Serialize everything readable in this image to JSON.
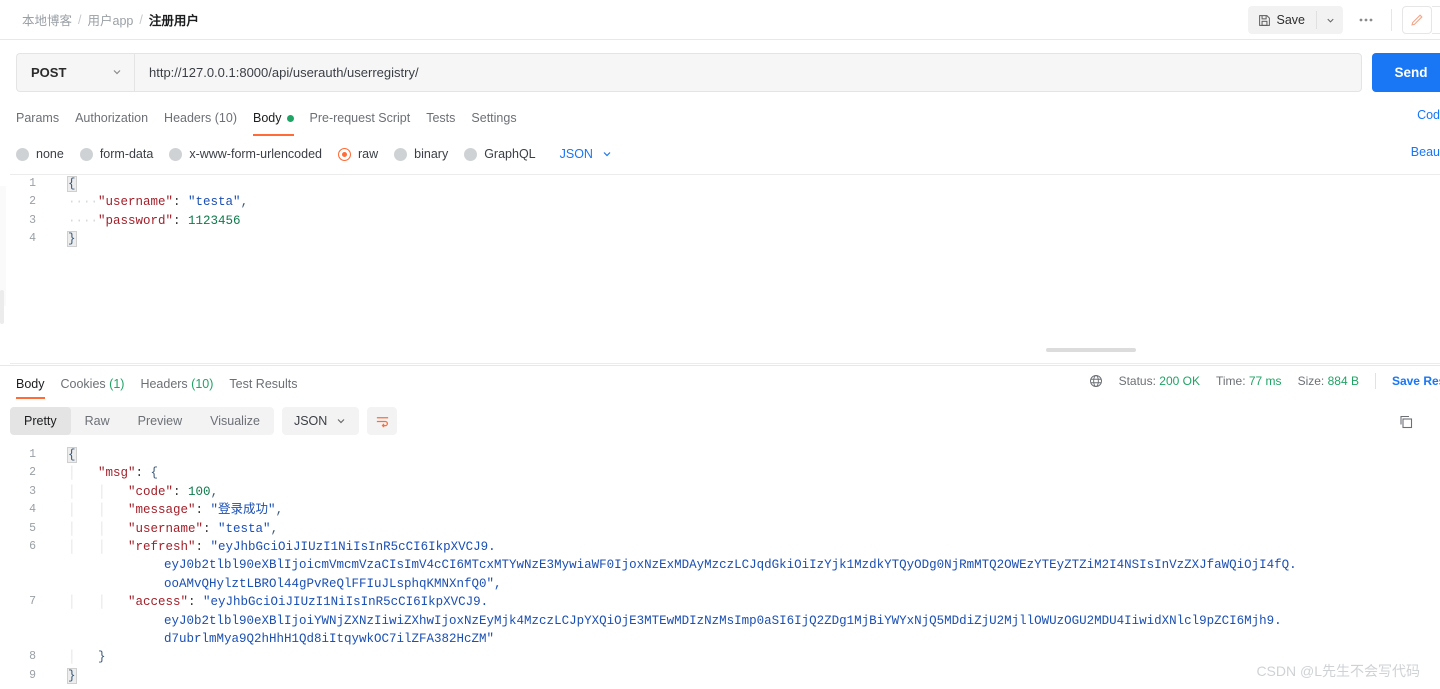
{
  "breadcrumb": {
    "items": [
      {
        "label": "本地博客",
        "current": false
      },
      {
        "label": "用户app",
        "current": false
      },
      {
        "label": "注册用户",
        "current": true
      }
    ],
    "separator": "/"
  },
  "toolbar": {
    "save_label": "Save",
    "save_icon": "floppy-disk-icon",
    "caret_icon": "chevron-down-icon",
    "more_icon": "ellipsis-icon",
    "edit_icon": "pencil-icon"
  },
  "request": {
    "method": "POST",
    "method_caret": "chevron-down-icon",
    "url": "http://127.0.0.1:8000/api/userauth/userregistry/",
    "send_label": "Send",
    "code_link": "Cod",
    "beautify_link": "Beau",
    "tabs": [
      {
        "label": "Params",
        "active": false,
        "dot": false
      },
      {
        "label": "Authorization",
        "active": false,
        "dot": false
      },
      {
        "label": "Headers (10)",
        "active": false,
        "dot": false
      },
      {
        "label": "Body",
        "active": true,
        "dot": true
      },
      {
        "label": "Pre-request Script",
        "active": false,
        "dot": false
      },
      {
        "label": "Tests",
        "active": false,
        "dot": false
      },
      {
        "label": "Settings",
        "active": false,
        "dot": false
      }
    ],
    "body_types": [
      {
        "label": "none",
        "selected": false
      },
      {
        "label": "form-data",
        "selected": false
      },
      {
        "label": "x-www-form-urlencoded",
        "selected": false
      },
      {
        "label": "raw",
        "selected": true
      },
      {
        "label": "binary",
        "selected": false
      },
      {
        "label": "GraphQL",
        "selected": false
      }
    ],
    "format": "JSON",
    "format_caret": "chevron-down-icon",
    "body_lines": [
      {
        "n": "1",
        "text": "{"
      },
      {
        "n": "2",
        "text": "    \"username\": \"testa\","
      },
      {
        "n": "3",
        "text": "    \"password\": 1123456"
      },
      {
        "n": "4",
        "text": "}"
      }
    ]
  },
  "response": {
    "tabs": [
      {
        "label": "Body",
        "count": "",
        "active": true
      },
      {
        "label": "Cookies",
        "count": "(1)",
        "active": false
      },
      {
        "label": "Headers",
        "count": "(10)",
        "active": false
      },
      {
        "label": "Test Results",
        "count": "",
        "active": false
      }
    ],
    "globe_icon": "globe-icon",
    "status_label": "Status:",
    "status_value": "200 OK",
    "time_label": "Time:",
    "time_value": "77 ms",
    "size_label": "Size:",
    "size_value": "884 B",
    "save_response": "Save Respons",
    "views": [
      {
        "label": "Pretty",
        "active": true
      },
      {
        "label": "Raw",
        "active": false
      },
      {
        "label": "Preview",
        "active": false
      },
      {
        "label": "Visualize",
        "active": false
      }
    ],
    "format": "JSON",
    "format_caret": "chevron-down-icon",
    "wrap_icon": "wrap-lines-icon",
    "copy_icon": "copy-icon",
    "lines": [
      {
        "n": "1",
        "text": "{"
      },
      {
        "n": "2",
        "text": "    \"msg\": {"
      },
      {
        "n": "3",
        "text": "        \"code\": 100,"
      },
      {
        "n": "4",
        "text": "        \"message\": \"登录成功\","
      },
      {
        "n": "5",
        "text": "        \"username\": \"testa\","
      },
      {
        "n": "6",
        "text": "        \"refresh\": \"eyJhbGciOiJIUzI1NiIsInR5cCI6IkpXVCJ9.eyJ0b2tlbl90eXBlIjoicmVmcmVzaCIsImV4cCI6MTcxMTYwNzE3MywiaWF0IjoxNzExMDAyMzczLCJqdGkiOiIzYjk1MzdkYTQyODg0NjRmMTQ2OWEzYTEyZTZiM2I4NSIsInVzZXJfaWQiOjI4fQ.ooAMvQHylztLBROl44gPvReQlFFIuJLsphqKMNXnfQ0\","
      },
      {
        "n": "7",
        "text": "        \"access\": \"eyJhbGciOiJIUzI1NiIsInR5cCI6IkpXVCJ9.eyJ0b2tlbl90eXBlIjoiYWNjZXNzIiwiZXhwIjoxNzEyMjk4MzczLCJpYXQiOjE3MTEwMDIzNzMsImp0aSI6IjQ2ZDg1MjBiYWYxNjQ5MDdiZjU2MjllOWUzOGU2MDU4IiwidXNlcl9pZCI6Mjh9.d7ubrlmMya9Q2hHhH1Qd8iItqywkOC7ilZFA382HcZM\""
      },
      {
        "n": "8",
        "text": "    }"
      },
      {
        "n": "9",
        "text": "}"
      }
    ],
    "line6_wrap": [
      "\"refresh\": \"eyJhbGciOiJIUzI1NiIsInR5cCI6IkpXVCJ9.",
      "eyJ0b2tlbl90eXBlIjoicmVmcmVzaCIsImV4cCI6MTcxMTYwNzE3MywiaWF0IjoxNzExMDAyMzczLCJqdGkiOiIzYjk1MzdkYTQyODg0NjRmMTQ2OWEzYTEyZTZiM2I4NSIsInVzZXJfaWQiOjI4fQ.",
      "ooAMvQHylztLBROl44gPvReQlFFIuJLsphqKMNXnfQ0\","
    ],
    "line7_wrap": [
      "\"access\": \"eyJhbGciOiJIUzI1NiIsInR5cCI6IkpXVCJ9.",
      "eyJ0b2tlbl90eXBlIjoiYWNjZXNzIiwiZXhwIjoxNzEyMjk4MzczLCJpYXQiOjE3MTEwMDIzNzMsImp0aSI6IjQ2ZDg1MjBiYWYxNjQ5MDdiZjU2MjllOWUzOGU2MDU4IiwidXNlcl9pZCI6Mjh9.",
      "d7ubrlmMya9Q2hHhH1Qd8iItqywkOC7ilZFA382HcZM\""
    ]
  },
  "watermark": "CSDN @L先生不会写代码"
}
